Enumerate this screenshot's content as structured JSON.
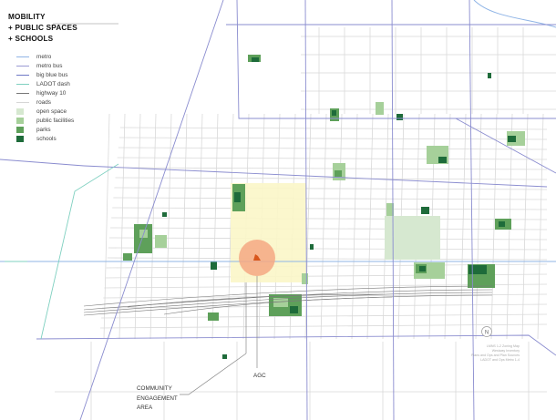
{
  "title": {
    "line1": "MOBILITY",
    "line2": "+ PUBLIC SPACES",
    "line3": "+ SCHOOLS"
  },
  "legend": [
    {
      "label": "metro",
      "type": "line",
      "color": "#8fb4e6"
    },
    {
      "label": "metro bus",
      "type": "line",
      "color": "#9a9ad4"
    },
    {
      "label": "big blue bus",
      "type": "line",
      "color": "#6f78c6"
    },
    {
      "label": "LADOT dash",
      "type": "line",
      "color": "#7fd0c0"
    },
    {
      "label": "highway 10",
      "type": "line",
      "color": "#777777"
    },
    {
      "label": "roads",
      "type": "line",
      "color": "#d6d6d6"
    },
    {
      "label": "open space",
      "type": "swatch",
      "color": "#d6e8d0"
    },
    {
      "label": "public facilities",
      "type": "swatch",
      "color": "#a6d09a"
    },
    {
      "label": "parks",
      "type": "swatch",
      "color": "#5ea05a"
    },
    {
      "label": "schools",
      "type": "swatch",
      "color": "#1e6b3a"
    }
  ],
  "annotations": {
    "site": "AGC",
    "area_line1": "COMMUNITY",
    "area_line2": "ENGAGEMENT",
    "area_line3": "AREA",
    "north_marker": "N"
  },
  "source_lines": [
    "LMNS 1-2 Zoning Map",
    "Westway Inventory",
    "Plans and Ops and Plan Sources",
    "LADOT and Ops Metro 1-4"
  ],
  "colors": {
    "engagement_area": "#fbf6c8",
    "site_halo": "#f4a882",
    "site_marker": "#d8561c"
  }
}
